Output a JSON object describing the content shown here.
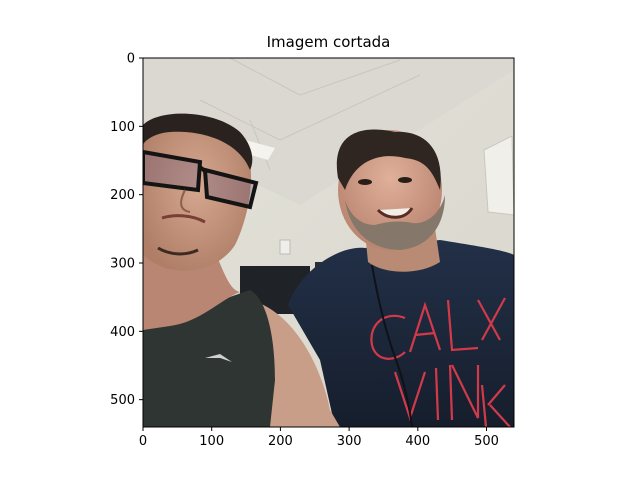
{
  "title": "Imagem cortada",
  "image": {
    "description_icon": "photo-selfie-two-men",
    "shirt_print_text": "CAL VIN KLE",
    "colors": {
      "wall": "#e6e4dc",
      "ceiling": "#dedbd2",
      "shirt_navy": "#1c2739",
      "tank_top": "#2f3532",
      "skin": "#c99a80",
      "hair": "#2a221e",
      "beard": "#8a7c70",
      "print_red": "#d23a4a"
    }
  },
  "axes": {
    "xlim": [
      0,
      540
    ],
    "ylim": [
      540,
      0
    ],
    "xticks": [
      0,
      100,
      200,
      300,
      400,
      500
    ],
    "yticks": [
      0,
      100,
      200,
      300,
      400,
      500
    ],
    "xtick_labels": [
      "0",
      "100",
      "200",
      "300",
      "400",
      "500"
    ],
    "ytick_labels": [
      "0",
      "100",
      "200",
      "300",
      "400",
      "500"
    ]
  }
}
